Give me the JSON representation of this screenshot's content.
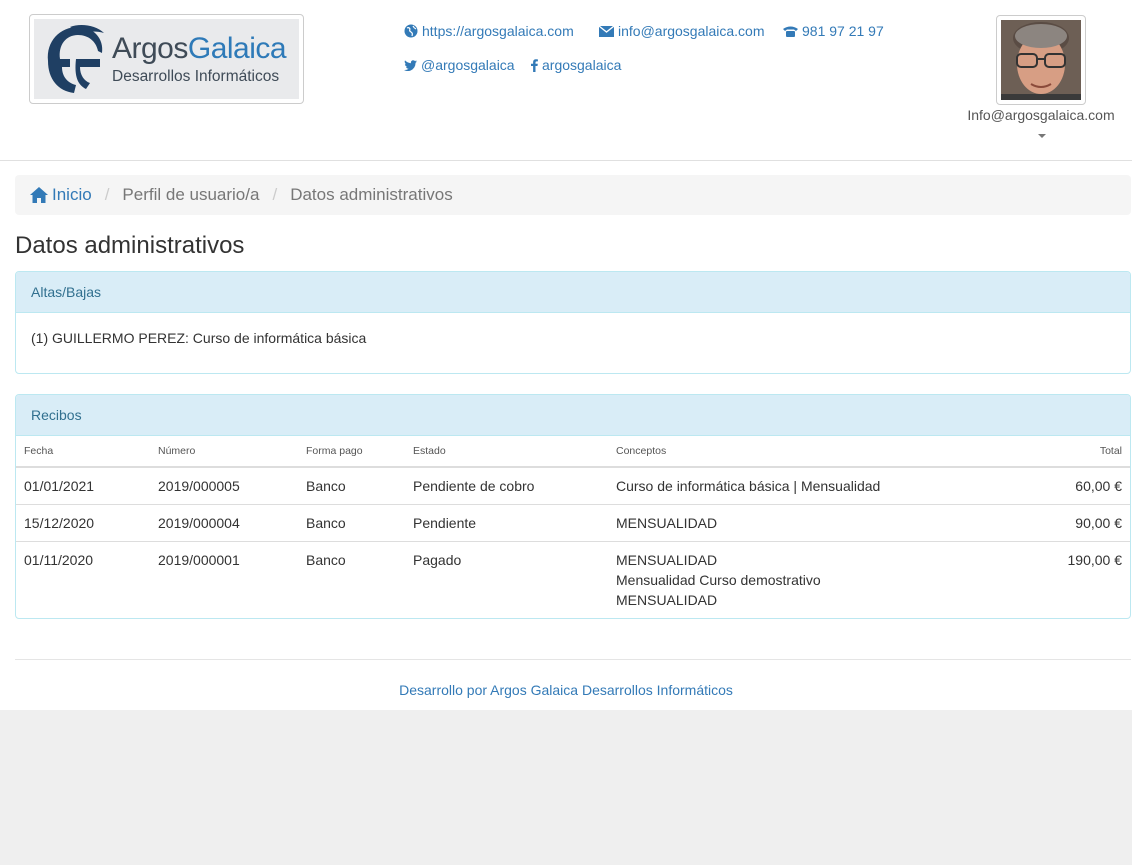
{
  "header": {
    "logo": {
      "brand_dark": "Argos",
      "brand_blue": "Galaica",
      "subtitle": "Desarrollos Informáticos"
    },
    "contacts": {
      "website": "https://argosgalaica.com",
      "email": "info@argosgalaica.com",
      "phone": "981 97 21 97",
      "twitter": "@argosgalaica",
      "facebook": "argosgalaica"
    },
    "user": {
      "email": "Info@argosgalaica.com"
    }
  },
  "breadcrumb": {
    "home": "Inicio",
    "items": [
      "Perfil de usuario/a",
      "Datos administrativos"
    ]
  },
  "page_title": "Datos administrativos",
  "altas": {
    "heading": "Altas/Bajas",
    "entry": "(1) GUILLERMO PEREZ: Curso de informática básica"
  },
  "recibos": {
    "heading": "Recibos",
    "columns": [
      "Fecha",
      "Número",
      "Forma pago",
      "Estado",
      "Conceptos",
      "Total"
    ],
    "rows": [
      {
        "fecha": "01/01/2021",
        "numero": "2019/000005",
        "forma_pago": "Banco",
        "estado": "Pendiente de cobro",
        "conceptos": [
          "Curso de informática básica | Mensualidad"
        ],
        "total": "60,00 €"
      },
      {
        "fecha": "15/12/2020",
        "numero": "2019/000004",
        "forma_pago": "Banco",
        "estado": "Pendiente",
        "conceptos": [
          "MENSUALIDAD"
        ],
        "total": "90,00 €"
      },
      {
        "fecha": "01/11/2020",
        "numero": "2019/000001",
        "forma_pago": "Banco",
        "estado": "Pagado",
        "conceptos": [
          "MENSUALIDAD",
          "Mensualidad Curso demostrativo",
          "MENSUALIDAD"
        ],
        "total": "190,00 €"
      }
    ]
  },
  "footer": {
    "text": "Desarrollo por Argos Galaica Desarrollos Informáticos"
  },
  "colors": {
    "link": "#337ab7",
    "panel_heading_bg": "#d9edf7",
    "panel_heading_text": "#31708f",
    "panel_border": "#bce8f1"
  }
}
